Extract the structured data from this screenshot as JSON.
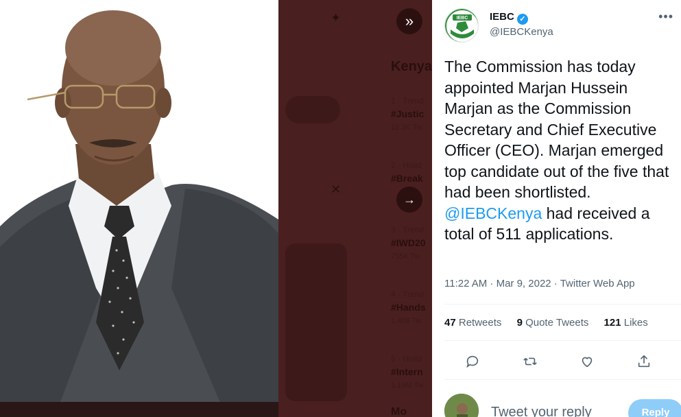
{
  "tweet": {
    "author_name": "IEBC",
    "handle": "@IEBCKenya",
    "verified": true,
    "avatar_logo_text": "IEBC",
    "text_before_mention": "The Commission has today appointed Marjan Hussein Marjan as the Commission Secretary and Chief Executive Officer (CEO). Marjan emerged top candidate out of the five that had been shortlisted.",
    "mention": "@IEBCKenya",
    "text_after_mention": " had received a total of 511 applications.",
    "timestamp": "11:22 AM · Mar 9, 2022 · Twitter Web App",
    "stats": {
      "retweets_count": "47",
      "retweets_label": "Retweets",
      "quote_count": "9",
      "quote_label": "Quote Tweets",
      "likes_count": "121",
      "likes_label": "Likes"
    },
    "more_icon": "more-icon"
  },
  "reply": {
    "placeholder": "Tweet your reply",
    "button_label": "Reply"
  },
  "background_page": {
    "header": "Kenya",
    "trends": [
      {
        "meta": "1 · Trend",
        "tag": "#Justic",
        "count": "12.3K Tw"
      },
      {
        "meta": "2 · Holid",
        "tag": "#Break",
        "count": ""
      },
      {
        "meta": "3 · Trend",
        "tag": "#IWD20",
        "count": "755K Tw"
      },
      {
        "meta": "4 · Trend",
        "tag": "#Hands",
        "count": "1,408 Tw"
      },
      {
        "meta": "5 · Holid",
        "tag": "#Intern",
        "count": "1.19M Tw"
      }
    ],
    "more_label": "Mo"
  },
  "colors": {
    "accent": "#1d9bf0",
    "reply_button": "#8ecdf8",
    "overlay": "#4a1f1f"
  }
}
